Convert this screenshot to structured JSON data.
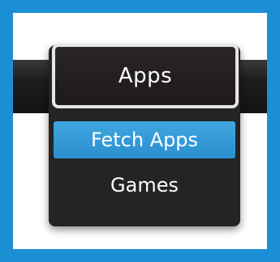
{
  "menu": {
    "button_label": "Apps",
    "items": [
      {
        "label": "Fetch Apps",
        "selected": true
      },
      {
        "label": "Games",
        "selected": false
      }
    ]
  },
  "colors": {
    "frame": "#1b8fd3",
    "selected_item": "#3fa6df",
    "menu_background": "#242424"
  }
}
